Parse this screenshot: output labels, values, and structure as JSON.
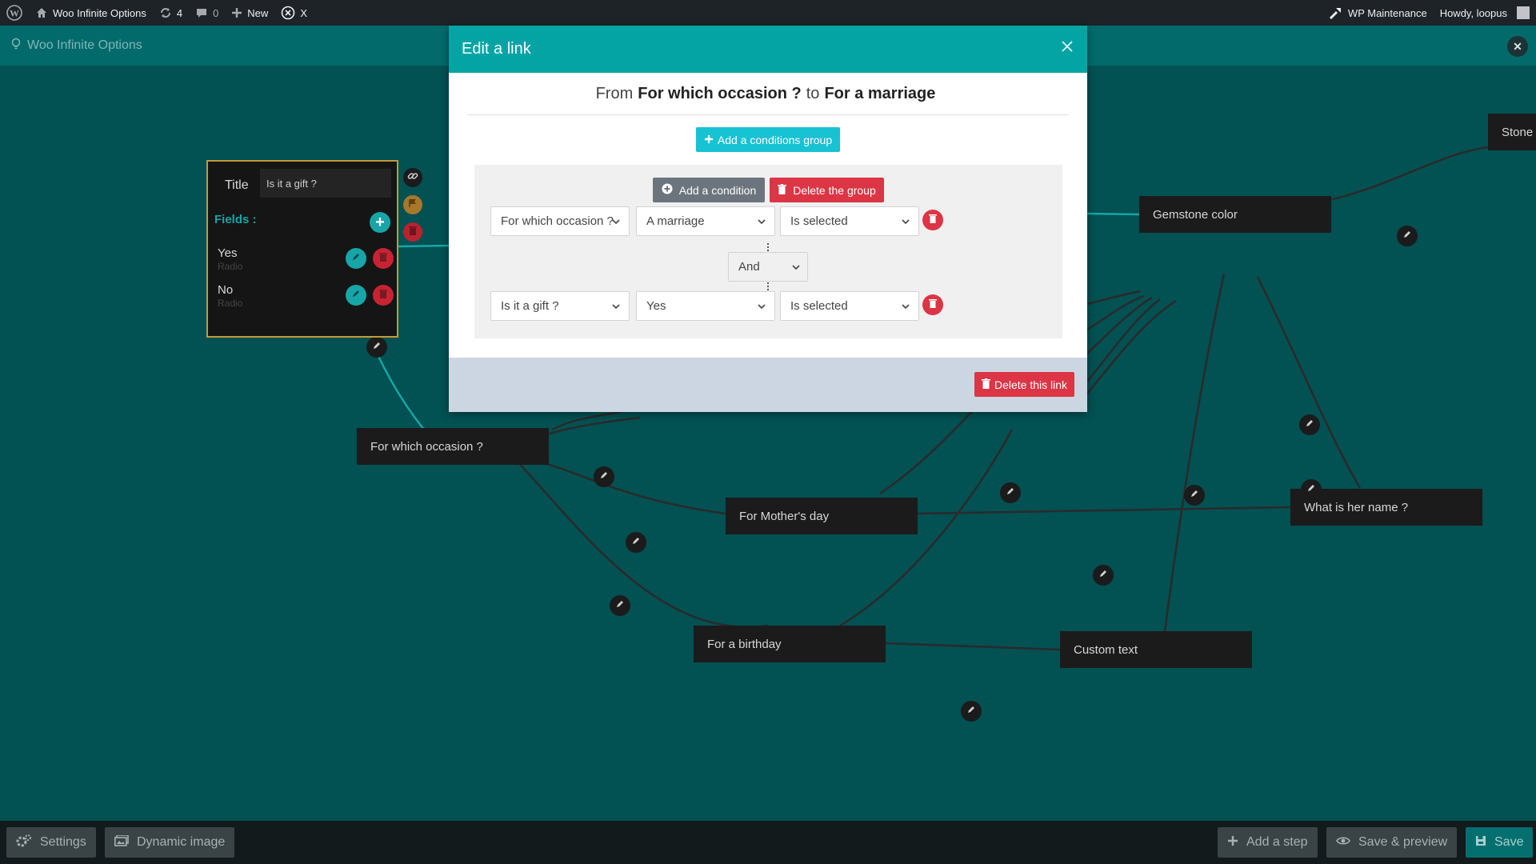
{
  "adminbar": {
    "site_name": "Woo Infinite Options",
    "updates_count": "4",
    "comments_count": "0",
    "new_label": "New",
    "x_label": "X",
    "maintenance_label": "WP Maintenance",
    "howdy_label": "Howdy, loopus"
  },
  "plugin": {
    "title": "Woo Infinite Options"
  },
  "step_card": {
    "title_label": "Title",
    "title_value": "Is it a gift ?",
    "fields_label": "Fields :",
    "fields": [
      {
        "name": "Yes",
        "type": "Radio"
      },
      {
        "name": "No",
        "type": "Radio"
      }
    ]
  },
  "nodes": {
    "for_which_occasion": "For which occasion ?",
    "for_mothers_day": "For Mother's day",
    "for_a_birthday": "For a birthday",
    "custom_text": "Custom text",
    "gemstone_color": "Gemstone color",
    "what_is_her_name": "What is her name ?",
    "stone": "Stone"
  },
  "modal": {
    "title": "Edit a link",
    "route_from_prefix": "From",
    "route_from": "For which occasion ?",
    "route_to_prefix": "to",
    "route_to": "For a marriage",
    "add_group_label": "Add a conditions group",
    "add_condition_label": "Add a condition",
    "delete_group_label": "Delete the group",
    "conditions": [
      {
        "field": "For which occasion ?",
        "value": "A marriage",
        "operator": "Is selected"
      },
      {
        "field": "Is it a gift ?",
        "value": "Yes",
        "operator": "Is selected"
      }
    ],
    "join_operator": "And",
    "delete_link_label": "Delete this link"
  },
  "bottombar": {
    "settings_label": "Settings",
    "dynamic_image_label": "Dynamic image",
    "add_step_label": "Add a step",
    "save_preview_label": "Save & preview",
    "save_label": "Save"
  },
  "colors": {
    "canvas_bg": "#025153",
    "modal_header": "#04a4a5",
    "danger": "#dc3545",
    "info": "#17c2d2",
    "accent_teal": "#17a5a7"
  }
}
